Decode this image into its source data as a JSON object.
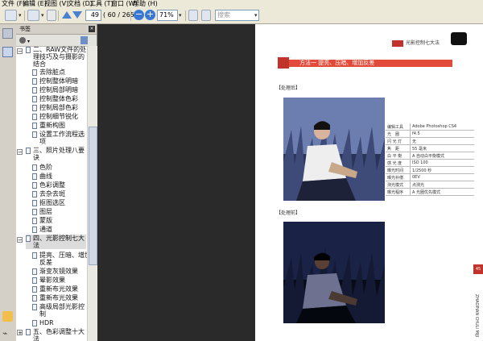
{
  "menu": [
    "文件 (F)",
    "编辑 (E)",
    "视图 (V)",
    "文档 (D)",
    "工具 (T)",
    "窗口 (W)",
    "帮助 (H)"
  ],
  "toolbar": {
    "page_number": "49",
    "page_total": "( 60 / 265 )",
    "zoom": "71%",
    "search_placeholder": "搜索"
  },
  "bookmarks_panel": {
    "title": "书签",
    "items": [
      {
        "text": "二、RAW文件的处"
      },
      {
        "text": "理技巧及与摄影的"
      },
      {
        "text": "结合"
      },
      {
        "text": "去除脏点"
      },
      {
        "text": "控制整体明暗"
      },
      {
        "text": "控制局部明暗"
      },
      {
        "text": "控制整体色彩"
      },
      {
        "text": "控制局部色彩"
      },
      {
        "text": "控制细节锐化"
      },
      {
        "text": "重新构图"
      },
      {
        "text": "设置工作流程选"
      },
      {
        "text": "项"
      },
      {
        "text": "三、照片处理八要"
      },
      {
        "text": "诀"
      },
      {
        "text": "色阶"
      },
      {
        "text": "曲线"
      },
      {
        "text": "色彩调整"
      },
      {
        "text": "去杂去斑"
      },
      {
        "text": "抠图选区"
      },
      {
        "text": "图层"
      },
      {
        "text": "蒙版"
      },
      {
        "text": "通道"
      },
      {
        "text": "四、光影控制七大"
      },
      {
        "text": "法"
      },
      {
        "text": "提亮、压暗、增加"
      },
      {
        "text": "反差"
      },
      {
        "text": "渐变灰镜效果"
      },
      {
        "text": "晕影效果"
      },
      {
        "text": "重新布光效果"
      },
      {
        "text": "重新布光效果"
      },
      {
        "text": "高级局部光影控"
      },
      {
        "text": "制"
      },
      {
        "text": "HDR"
      },
      {
        "text": "五、色彩调整十大"
      },
      {
        "text": "法"
      }
    ]
  },
  "document": {
    "header_text": "光影控制七大法",
    "title": "方法一  提亮、压暗、增加反差",
    "after_label": "【处理后】",
    "before_label": "【处理前】",
    "info": [
      {
        "k": "编辑工具",
        "v": "Adobe Photoshop CS4"
      },
      {
        "k": "光　圈",
        "v": "f4.5"
      },
      {
        "k": "闪 光 灯",
        "v": "无"
      },
      {
        "k": "焦　距",
        "v": "55 毫米"
      },
      {
        "k": "白 平 衡",
        "v": "A 自动白平衡模式"
      },
      {
        "k": "感 光 度",
        "v": "ISO 100"
      },
      {
        "k": "曝光时间",
        "v": "1/2500 秒"
      },
      {
        "k": "曝光补偿",
        "v": "0EV"
      },
      {
        "k": "测光模式",
        "v": "点测光"
      },
      {
        "k": "曝光程序",
        "v": "A 光圈优先模式"
      }
    ],
    "side_tab": "45",
    "side_text": "ZHAOPIAN CHULI MIJI"
  },
  "colors": {
    "accent": "#c0322a",
    "title_bar": "#e24b3a",
    "dark_bg": "#2a2a2a"
  }
}
